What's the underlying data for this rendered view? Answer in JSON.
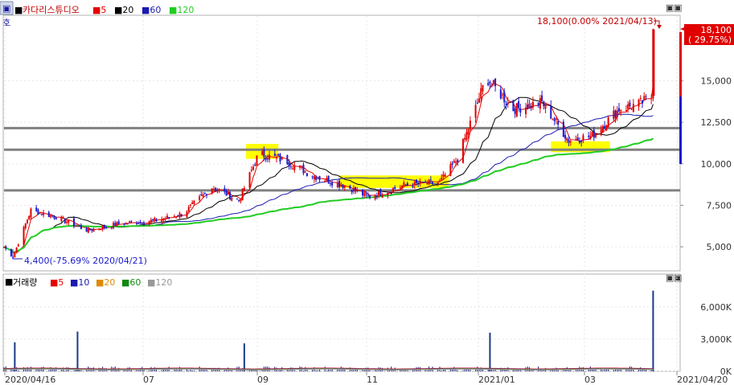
{
  "header": {
    "title": "카다리스튜디오",
    "ma_legend": [
      {
        "label": "5",
        "color": "#e60000"
      },
      {
        "label": "20",
        "color": "#000000"
      },
      {
        "label": "60",
        "color": "#1a1ab0"
      },
      {
        "label": "120",
        "color": "#22cc22"
      }
    ],
    "corner_icon": "menu-icon"
  },
  "price_panel": {
    "yticks": [
      "15,000",
      "12,500",
      "10,000",
      "7,500",
      "5,000"
    ],
    "ytick_values": [
      15000,
      12500,
      10000,
      7500,
      5000
    ],
    "last_price": "18,100",
    "last_change": "( 29.75%)",
    "high_annotation": "18,100(0.00% 2021/04/13)",
    "low_annotation": "4,400(-75.69% 2020/04/21)",
    "support_lines": [
      12150,
      10850,
      8400
    ]
  },
  "volume_panel": {
    "title": "거래량",
    "ma_legend": [
      {
        "label": "5",
        "color": "#e60000"
      },
      {
        "label": "10",
        "color": "#1a1ab0"
      },
      {
        "label": "20",
        "color": "#e08a00"
      },
      {
        "label": "60",
        "color": "#118811"
      },
      {
        "label": "120",
        "color": "#999999"
      }
    ],
    "yticks": [
      "6,000K",
      "3,000K",
      "0K"
    ],
    "ytick_values": [
      6000,
      3000,
      0
    ]
  },
  "x_axis": {
    "labels": [
      "2020/04/16",
      "07",
      "09",
      "11",
      "2021/01",
      "03",
      "2021/04/20"
    ]
  },
  "colors": {
    "up": "#e00000",
    "down": "#1a1acc",
    "ma5": "#e60000",
    "ma20": "#000000",
    "ma60": "#1a1ab0",
    "ma120": "#22cc22",
    "highlight": "#ffff00",
    "support": "#808080"
  },
  "chart_data": {
    "type": "candlestick",
    "title": "카다리스튜디오",
    "x_range": [
      "2020/04/16",
      "2021/04/20"
    ],
    "ylim": [
      3600,
      18900
    ],
    "price_waypoints": [
      {
        "date": "2020/04/16",
        "close": 5000
      },
      {
        "date": "2020/04/21",
        "close": 4400
      },
      {
        "date": "2020/05/01",
        "close": 7200
      },
      {
        "date": "2020/05/15",
        "close": 6800
      },
      {
        "date": "2020/06/01",
        "close": 6000
      },
      {
        "date": "2020/06/20",
        "close": 6400
      },
      {
        "date": "2020/07/10",
        "close": 6600
      },
      {
        "date": "2020/07/25",
        "close": 7000
      },
      {
        "date": "2020/08/10",
        "close": 8600
      },
      {
        "date": "2020/08/25",
        "close": 7800
      },
      {
        "date": "2020/09/05",
        "close": 10600
      },
      {
        "date": "2020/09/20",
        "close": 10200
      },
      {
        "date": "2020/10/05",
        "close": 9300
      },
      {
        "date": "2020/10/25",
        "close": 8600
      },
      {
        "date": "2020/11/05",
        "close": 8000
      },
      {
        "date": "2020/11/25",
        "close": 8700
      },
      {
        "date": "2020/12/15",
        "close": 8900
      },
      {
        "date": "2020/12/25",
        "close": 10300
      },
      {
        "date": "2021/01/10",
        "close": 15200
      },
      {
        "date": "2021/01/25",
        "close": 13300
      },
      {
        "date": "2021/02/10",
        "close": 13700
      },
      {
        "date": "2021/02/25",
        "close": 11400
      },
      {
        "date": "2021/03/10",
        "close": 11700
      },
      {
        "date": "2021/03/25",
        "close": 13300
      },
      {
        "date": "2021/04/05",
        "close": 13600
      },
      {
        "date": "2021/04/12",
        "close": 14000
      },
      {
        "date": "2021/04/13",
        "close": 18100
      }
    ],
    "moving_averages": [
      "5",
      "20",
      "60",
      "120"
    ],
    "volume_ylim": [
      0,
      8000
    ],
    "volume_spikes": [
      {
        "date": "2020/04/22",
        "volume": 2700
      },
      {
        "date": "2020/05/27",
        "volume": 3700
      },
      {
        "date": "2020/08/28",
        "volume": 2600
      },
      {
        "date": "2021/01/12",
        "volume": 3600
      },
      {
        "date": "2021/04/13",
        "volume": 7500
      }
    ]
  }
}
